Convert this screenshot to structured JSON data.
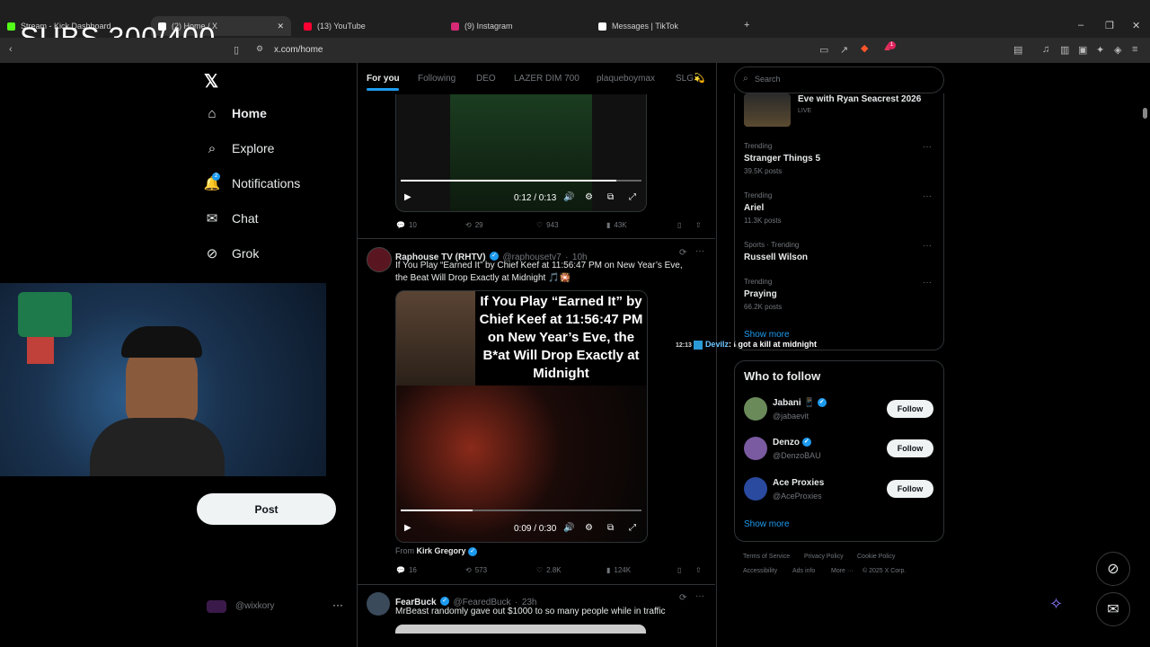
{
  "browser": {
    "tabs": [
      {
        "label": "Stream - Kick Dashboard",
        "color": "#53fc18"
      },
      {
        "label": "(2) Home / X",
        "color": "#ffffff"
      },
      {
        "label": "(13) YouTube",
        "color": "#ff0033"
      },
      {
        "label": "(9) Instagram",
        "color": "#d62976"
      },
      {
        "label": "Messages | TikTok",
        "color": "#ffffff"
      }
    ],
    "url": "x.com/home",
    "overlay_text": "SUBS 300/400",
    "notification_badge": "1"
  },
  "nav": {
    "items": [
      {
        "label": "Home",
        "icon": "home-icon"
      },
      {
        "label": "Explore",
        "icon": "search-icon"
      },
      {
        "label": "Notifications",
        "icon": "bell-icon",
        "badge": "2"
      },
      {
        "label": "Chat",
        "icon": "envelope-icon"
      },
      {
        "label": "Grok",
        "icon": "grok-icon"
      }
    ],
    "post_label": "Post",
    "account_handle": "@wixkory"
  },
  "feed": {
    "tabs": [
      "For you",
      "Following",
      "DEO",
      "LAZER DIM 700",
      "plaqueboymax",
      "SLG💫"
    ],
    "tweet1": {
      "video_time": "0:12 / 0:13",
      "replies": "10",
      "reposts": "29",
      "likes": "943",
      "views": "43K"
    },
    "tweet2": {
      "name": "Raphouse TV (RHTV)",
      "handle": "@raphousetv7",
      "time": "10h",
      "text": "If You Play “Earned It” by Chief Keef at 11:56:47 PM on New Year’s Eve, the Beat Will Drop Exactly at Midnight 🎵🎇",
      "image_text": "If You Play “Earned It” by Chief Keef at 11:56:47 PM on New Year’s Eve, the B*at Will Drop Exactly at Midnight",
      "video_time": "0:09 / 0:30",
      "from_label": "From",
      "from_name": "Kirk Gregory",
      "replies": "16",
      "reposts": "573",
      "likes": "2.8K",
      "views": "124K"
    },
    "tweet3": {
      "name": "FearBuck",
      "handle": "@FearedBuck",
      "time": "23h",
      "text": "MrBeast randomly gave out $1000 to so many people while in traffic"
    }
  },
  "chat_overlay": {
    "time": "12:13",
    "user": "Devilz",
    "message": "I got a kill at midnight"
  },
  "sidebar": {
    "search_placeholder": "Search",
    "live": {
      "title": "Eve with Ryan Seacrest 2026",
      "badge": "LIVE"
    },
    "trends": [
      {
        "category": "Trending",
        "name": "Stranger Things 5",
        "count": "39.5K posts"
      },
      {
        "category": "Trending",
        "name": "Ariel",
        "count": "11.3K posts"
      },
      {
        "category": "Sports · Trending",
        "name": "Russell Wilson",
        "count": ""
      },
      {
        "category": "Trending",
        "name": "Praying",
        "count": "66.2K posts"
      }
    ],
    "show_more": "Show more",
    "who_to_follow": {
      "title": "Who to follow",
      "accounts": [
        {
          "name": "Jabani 📱",
          "handle": "@jabaevit",
          "color": "#6a8a5a"
        },
        {
          "name": "Denzo",
          "handle": "@DenzoBAU",
          "color": "#7a5aa0"
        },
        {
          "name": "Ace Proxies",
          "handle": "@AceProxies",
          "color": "#2a4aa0"
        }
      ],
      "follow_label": "Follow",
      "show_more": "Show more"
    },
    "footer": [
      "Terms of Service",
      "Privacy Policy",
      "Cookie Policy",
      "Accessibility",
      "Ads info",
      "More ···",
      "© 2025 X Corp."
    ]
  }
}
